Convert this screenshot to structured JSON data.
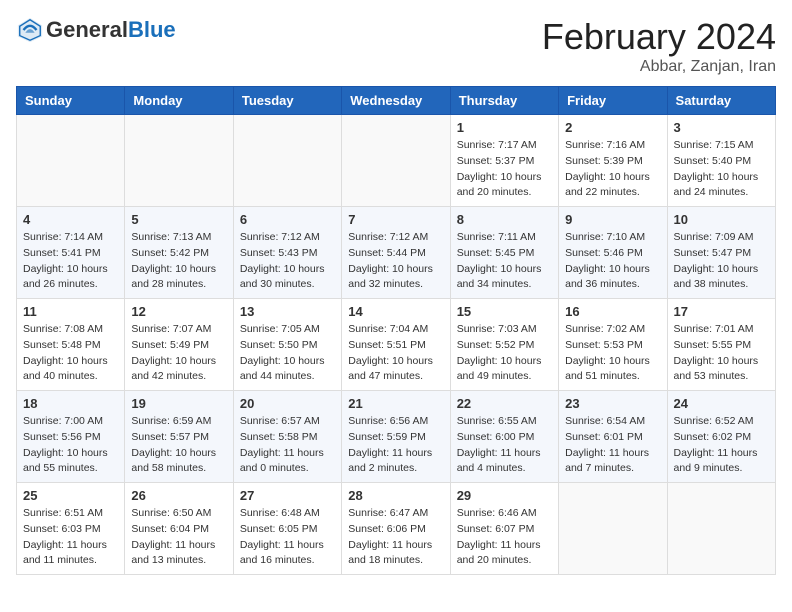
{
  "header": {
    "logo": {
      "general": "General",
      "blue": "Blue"
    },
    "title": "February 2024",
    "subtitle": "Abbar, Zanjan, Iran"
  },
  "weekdays": [
    "Sunday",
    "Monday",
    "Tuesday",
    "Wednesday",
    "Thursday",
    "Friday",
    "Saturday"
  ],
  "weeks": [
    [
      {
        "day": "",
        "info": ""
      },
      {
        "day": "",
        "info": ""
      },
      {
        "day": "",
        "info": ""
      },
      {
        "day": "",
        "info": ""
      },
      {
        "day": "1",
        "info": "Sunrise: 7:17 AM\nSunset: 5:37 PM\nDaylight: 10 hours\nand 20 minutes."
      },
      {
        "day": "2",
        "info": "Sunrise: 7:16 AM\nSunset: 5:39 PM\nDaylight: 10 hours\nand 22 minutes."
      },
      {
        "day": "3",
        "info": "Sunrise: 7:15 AM\nSunset: 5:40 PM\nDaylight: 10 hours\nand 24 minutes."
      }
    ],
    [
      {
        "day": "4",
        "info": "Sunrise: 7:14 AM\nSunset: 5:41 PM\nDaylight: 10 hours\nand 26 minutes."
      },
      {
        "day": "5",
        "info": "Sunrise: 7:13 AM\nSunset: 5:42 PM\nDaylight: 10 hours\nand 28 minutes."
      },
      {
        "day": "6",
        "info": "Sunrise: 7:12 AM\nSunset: 5:43 PM\nDaylight: 10 hours\nand 30 minutes."
      },
      {
        "day": "7",
        "info": "Sunrise: 7:12 AM\nSunset: 5:44 PM\nDaylight: 10 hours\nand 32 minutes."
      },
      {
        "day": "8",
        "info": "Sunrise: 7:11 AM\nSunset: 5:45 PM\nDaylight: 10 hours\nand 34 minutes."
      },
      {
        "day": "9",
        "info": "Sunrise: 7:10 AM\nSunset: 5:46 PM\nDaylight: 10 hours\nand 36 minutes."
      },
      {
        "day": "10",
        "info": "Sunrise: 7:09 AM\nSunset: 5:47 PM\nDaylight: 10 hours\nand 38 minutes."
      }
    ],
    [
      {
        "day": "11",
        "info": "Sunrise: 7:08 AM\nSunset: 5:48 PM\nDaylight: 10 hours\nand 40 minutes."
      },
      {
        "day": "12",
        "info": "Sunrise: 7:07 AM\nSunset: 5:49 PM\nDaylight: 10 hours\nand 42 minutes."
      },
      {
        "day": "13",
        "info": "Sunrise: 7:05 AM\nSunset: 5:50 PM\nDaylight: 10 hours\nand 44 minutes."
      },
      {
        "day": "14",
        "info": "Sunrise: 7:04 AM\nSunset: 5:51 PM\nDaylight: 10 hours\nand 47 minutes."
      },
      {
        "day": "15",
        "info": "Sunrise: 7:03 AM\nSunset: 5:52 PM\nDaylight: 10 hours\nand 49 minutes."
      },
      {
        "day": "16",
        "info": "Sunrise: 7:02 AM\nSunset: 5:53 PM\nDaylight: 10 hours\nand 51 minutes."
      },
      {
        "day": "17",
        "info": "Sunrise: 7:01 AM\nSunset: 5:55 PM\nDaylight: 10 hours\nand 53 minutes."
      }
    ],
    [
      {
        "day": "18",
        "info": "Sunrise: 7:00 AM\nSunset: 5:56 PM\nDaylight: 10 hours\nand 55 minutes."
      },
      {
        "day": "19",
        "info": "Sunrise: 6:59 AM\nSunset: 5:57 PM\nDaylight: 10 hours\nand 58 minutes."
      },
      {
        "day": "20",
        "info": "Sunrise: 6:57 AM\nSunset: 5:58 PM\nDaylight: 11 hours\nand 0 minutes."
      },
      {
        "day": "21",
        "info": "Sunrise: 6:56 AM\nSunset: 5:59 PM\nDaylight: 11 hours\nand 2 minutes."
      },
      {
        "day": "22",
        "info": "Sunrise: 6:55 AM\nSunset: 6:00 PM\nDaylight: 11 hours\nand 4 minutes."
      },
      {
        "day": "23",
        "info": "Sunrise: 6:54 AM\nSunset: 6:01 PM\nDaylight: 11 hours\nand 7 minutes."
      },
      {
        "day": "24",
        "info": "Sunrise: 6:52 AM\nSunset: 6:02 PM\nDaylight: 11 hours\nand 9 minutes."
      }
    ],
    [
      {
        "day": "25",
        "info": "Sunrise: 6:51 AM\nSunset: 6:03 PM\nDaylight: 11 hours\nand 11 minutes."
      },
      {
        "day": "26",
        "info": "Sunrise: 6:50 AM\nSunset: 6:04 PM\nDaylight: 11 hours\nand 13 minutes."
      },
      {
        "day": "27",
        "info": "Sunrise: 6:48 AM\nSunset: 6:05 PM\nDaylight: 11 hours\nand 16 minutes."
      },
      {
        "day": "28",
        "info": "Sunrise: 6:47 AM\nSunset: 6:06 PM\nDaylight: 11 hours\nand 18 minutes."
      },
      {
        "day": "29",
        "info": "Sunrise: 6:46 AM\nSunset: 6:07 PM\nDaylight: 11 hours\nand 20 minutes."
      },
      {
        "day": "",
        "info": ""
      },
      {
        "day": "",
        "info": ""
      }
    ]
  ]
}
